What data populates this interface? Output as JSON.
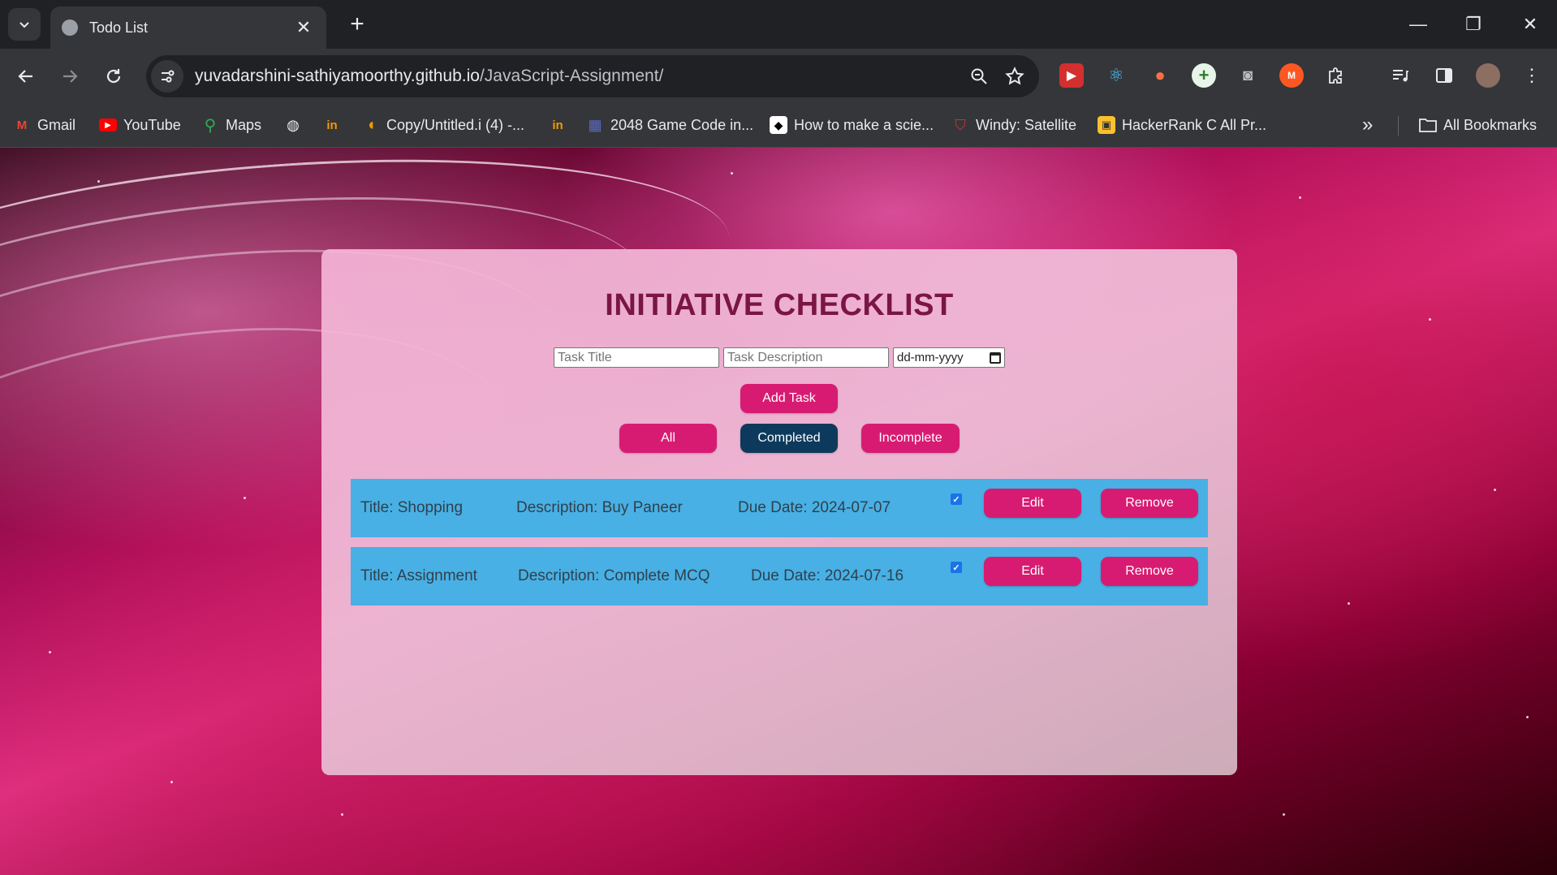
{
  "browser": {
    "tab_title": "Todo List",
    "tab_close": "✕",
    "new_tab": "+",
    "url_host": "yuvadarshini-sathiyamoorthy.github.io",
    "url_path": "/JavaScript-Assignment/",
    "window_controls": {
      "minimize": "—",
      "restore": "❐",
      "close": "✕"
    },
    "bookmarks": [
      {
        "label": "Gmail"
      },
      {
        "label": "YouTube"
      },
      {
        "label": "Maps"
      },
      {
        "label": "Copy/Untitled.i (4) -..."
      },
      {
        "label": "2048 Game Code in..."
      },
      {
        "label": "How to make a scie..."
      },
      {
        "label": "Windy: Satellite"
      },
      {
        "label": "HackerRank C All Pr..."
      }
    ],
    "bookmarks_overflow": "»",
    "all_bookmarks": "All Bookmarks"
  },
  "app": {
    "heading": "INITIATIVE CHECKLIST",
    "inputs": {
      "title_placeholder": "Task Title",
      "description_placeholder": "Task Description",
      "date_placeholder": "dd-mm-yyyy"
    },
    "add_button": "Add Task",
    "filters": [
      {
        "label": "All",
        "active": false
      },
      {
        "label": "Completed",
        "active": true
      },
      {
        "label": "Incomplete",
        "active": false
      }
    ],
    "tasks": [
      {
        "title": "Title: Shopping",
        "description": "Description: Buy Paneer",
        "due": "Due Date: 2024-07-07",
        "completed": true,
        "edit": "Edit",
        "remove": "Remove"
      },
      {
        "title": "Title: Assignment",
        "description": "Description: Complete MCQ",
        "due": "Due Date: 2024-07-16",
        "completed": true,
        "edit": "Edit",
        "remove": "Remove"
      }
    ]
  },
  "colors": {
    "accent": "#d81b72",
    "active_filter": "#0d3a5c",
    "task_row": "#48b0e4",
    "heading": "#7a1545"
  }
}
